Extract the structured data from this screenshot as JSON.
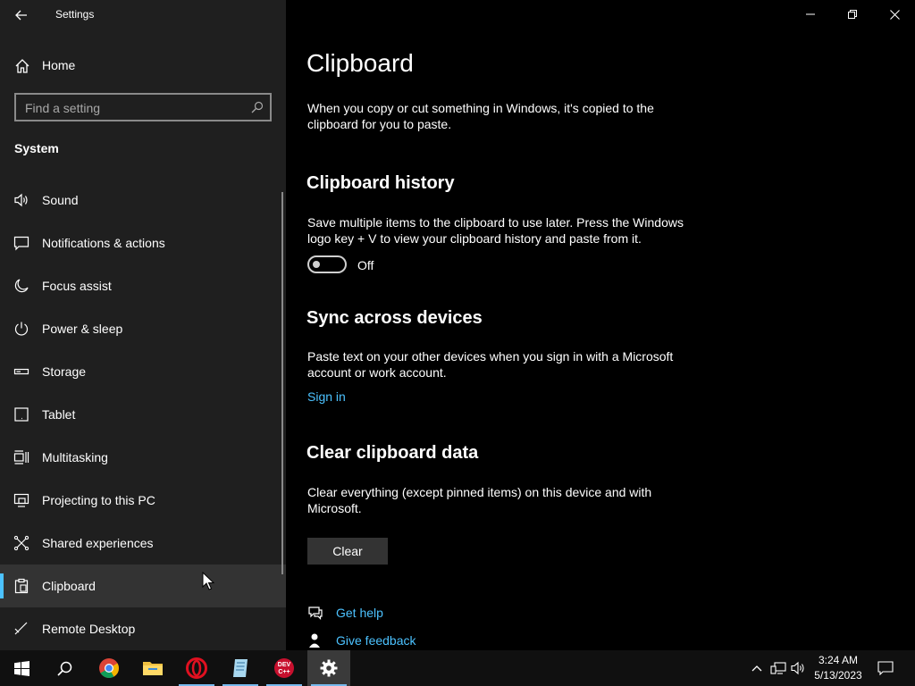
{
  "window": {
    "title": "Settings"
  },
  "sidebar": {
    "home_label": "Home",
    "search_placeholder": "Find a setting",
    "section_title": "System",
    "items": [
      {
        "label": "Sound",
        "icon": "speaker-icon"
      },
      {
        "label": "Notifications & actions",
        "icon": "notification-icon"
      },
      {
        "label": "Focus assist",
        "icon": "moon-icon"
      },
      {
        "label": "Power & sleep",
        "icon": "power-icon"
      },
      {
        "label": "Storage",
        "icon": "storage-icon"
      },
      {
        "label": "Tablet",
        "icon": "tablet-icon"
      },
      {
        "label": "Multitasking",
        "icon": "multitasking-icon"
      },
      {
        "label": "Projecting to this PC",
        "icon": "projecting-icon"
      },
      {
        "label": "Shared experiences",
        "icon": "shared-experiences-icon"
      },
      {
        "label": "Clipboard",
        "icon": "clipboard-icon",
        "selected": true
      },
      {
        "label": "Remote Desktop",
        "icon": "remote-desktop-icon"
      }
    ]
  },
  "main": {
    "title": "Clipboard",
    "intro": "When you copy or cut something in Windows, it's copied to the clipboard for you to paste.",
    "history": {
      "heading": "Clipboard history",
      "description": "Save multiple items to the clipboard to use later. Press the Windows logo key + V to view your clipboard history and paste from it.",
      "toggle_state": "Off"
    },
    "sync": {
      "heading": "Sync across devices",
      "description": "Paste text on your other devices when you sign in with a Microsoft account or work account.",
      "link": "Sign in"
    },
    "clear": {
      "heading": "Clear clipboard data",
      "description": "Clear everything (except pinned items) on this device and with Microsoft.",
      "button": "Clear"
    },
    "help": {
      "get_help": "Get help",
      "give_feedback": "Give feedback"
    }
  },
  "taskbar": {
    "apps": [
      "start",
      "search",
      "chrome",
      "file-explorer",
      "opera",
      "notepad",
      "dev-cpp",
      "settings"
    ],
    "devcpp_text": "DEV C++",
    "time": "3:24 AM",
    "date": "5/13/2023"
  },
  "colors": {
    "accent": "#4cc2ff",
    "sidebar_bg": "#1f1f1f",
    "main_bg": "#000000",
    "selected_bg": "#333333",
    "taskbar_bg": "#101010"
  }
}
